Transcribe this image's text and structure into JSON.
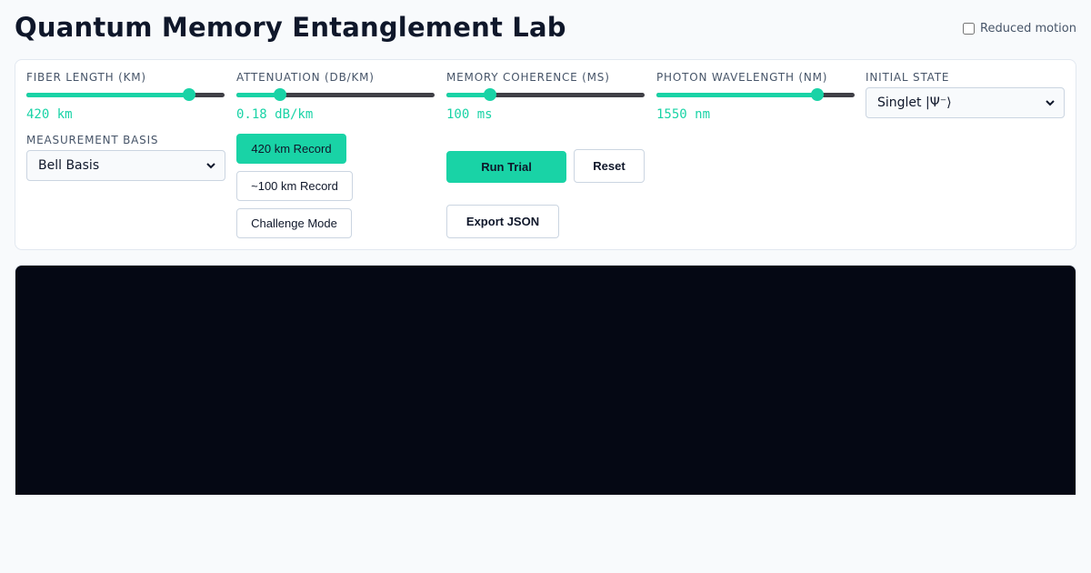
{
  "app": {
    "title": "Quantum Memory Entanglement Lab"
  },
  "reduced_motion": {
    "label": "Reduced motion",
    "checked": false
  },
  "controls": {
    "fiber_length": {
      "label": "FIBER LENGTH (KM)",
      "value_text": "420 km",
      "value": 420,
      "level": 0.82
    },
    "attenuation": {
      "label": "ATTENUATION (DB/KM)",
      "value_text": "0.18 dB/km",
      "value": 0.18,
      "level": 0.22
    },
    "memory_coherence": {
      "label": "MEMORY COHERENCE (MS)",
      "value_text": "100 ms",
      "value": 100,
      "level": 0.22
    },
    "photon_wavelength": {
      "label": "PHOTON WAVELENGTH (NM)",
      "value_text": "1550 nm",
      "value": 1550,
      "level": 0.81
    },
    "initial_state": {
      "label": "INITIAL STATE",
      "selected": "Singlet |Ψ⁻⟩"
    },
    "measurement_basis": {
      "label": "MEASUREMENT BASIS",
      "selected": "Bell Basis"
    }
  },
  "presets": {
    "record_420": "420 km Record",
    "record_100": "~100 km Record",
    "challenge": "Challenge Mode"
  },
  "actions": {
    "run": "Run Trial",
    "reset": "Reset",
    "export": "Export JSON"
  },
  "colors": {
    "accent": "#19d3a6",
    "track": "#3f3f46",
    "canvas_bg": "#050814",
    "page_bg": "#f8fafc"
  }
}
